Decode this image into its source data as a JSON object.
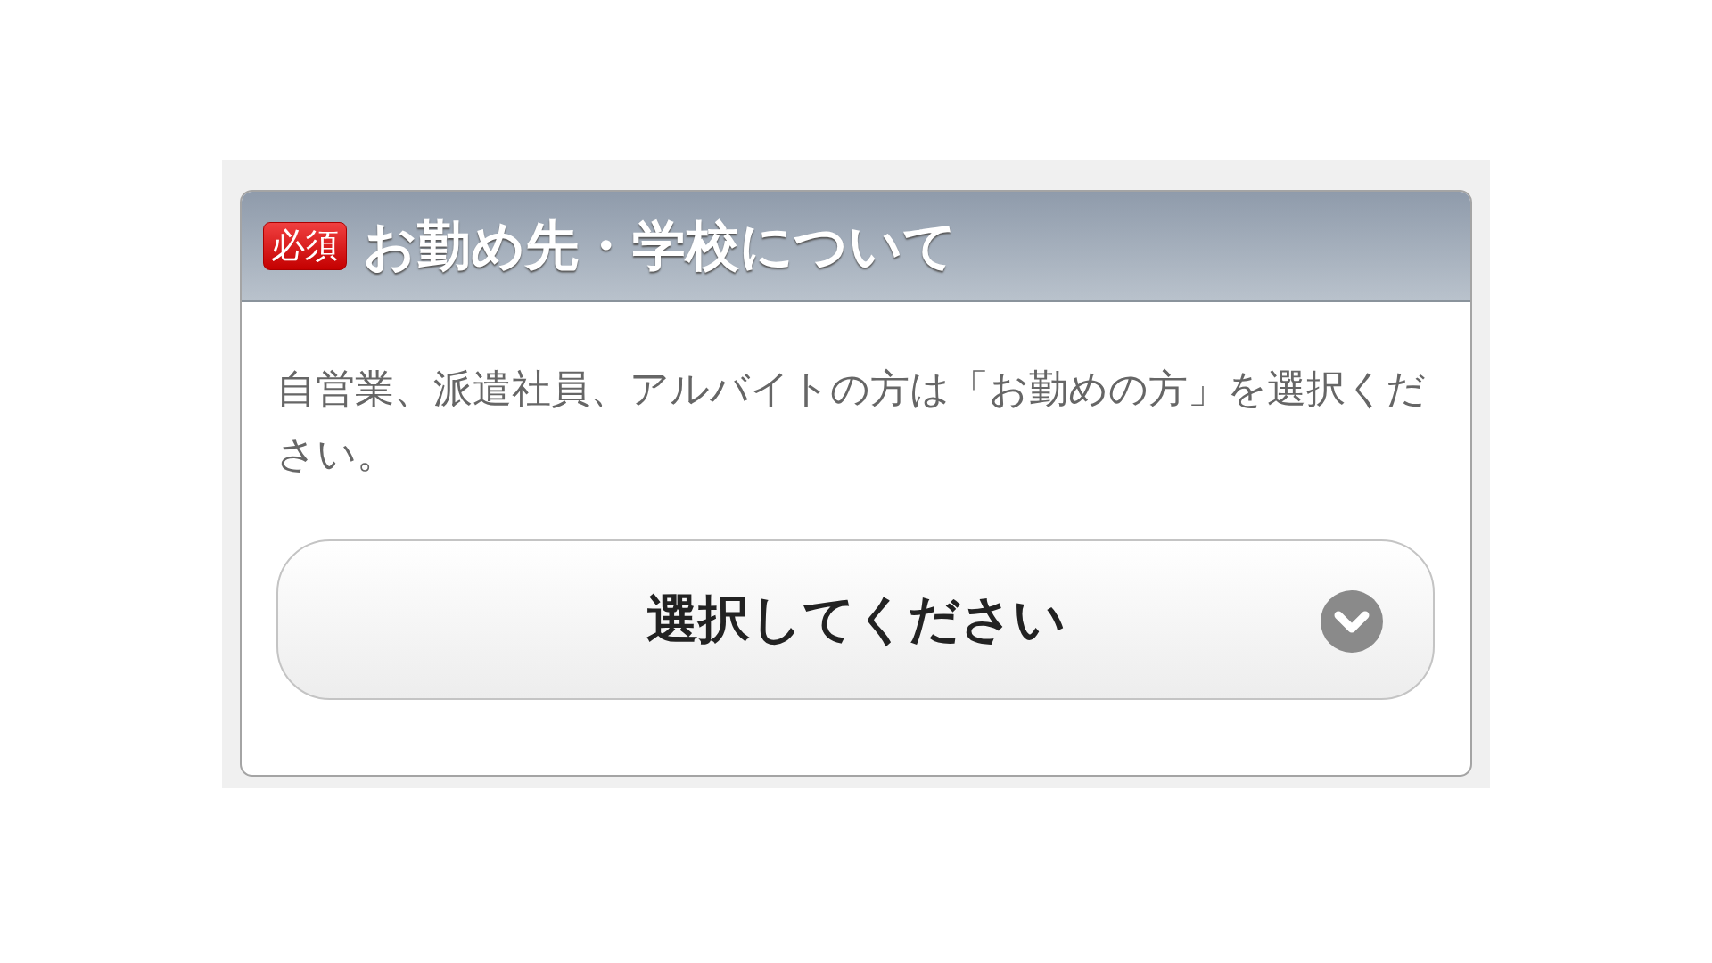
{
  "section": {
    "required_badge": "必須",
    "title": "お勤め先・学校について",
    "description": "自営業、派遣社員、アルバイトの方は「お勤めの方」を選択ください。",
    "select": {
      "label": "選択してください"
    }
  }
}
